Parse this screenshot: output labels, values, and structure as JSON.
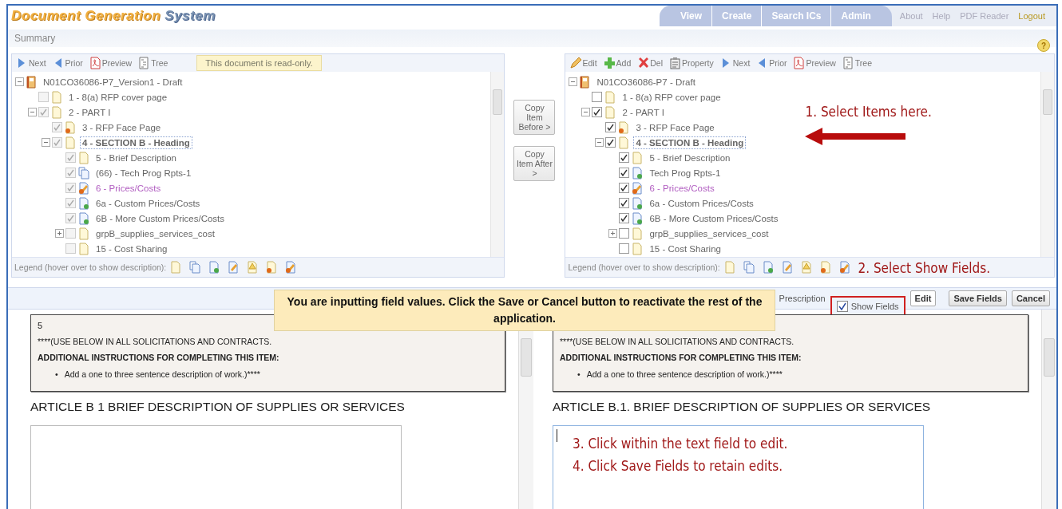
{
  "header": {
    "logo_part_1": "Document Generation",
    "logo_part_2": "System",
    "nav_tabs": [
      "View",
      "Create",
      "Search ICs",
      "Admin"
    ],
    "links": [
      {
        "label": "About",
        "kind": "plain"
      },
      {
        "label": "Help",
        "kind": "plain"
      },
      {
        "label": "PDF Reader",
        "kind": "plain"
      },
      {
        "label": "Logout",
        "kind": "logout"
      }
    ]
  },
  "summary_bar": {
    "title": "Summary",
    "help": "?"
  },
  "left_panel": {
    "disabled": true,
    "notice": "This document is read-only.",
    "toolbar": [
      {
        "label": "Next",
        "kind": "next"
      },
      {
        "label": "Prior",
        "kind": "prior"
      },
      {
        "label": "Preview",
        "kind": "pdf"
      },
      {
        "label": "Tree",
        "kind": "tree"
      }
    ],
    "tree": {
      "label": "N01CO36086-P7_Version1 - Draft",
      "kind": "book",
      "expanded": true,
      "selected": false,
      "children": [
        {
          "label": "1 - 8(a) RFP cover page",
          "kind": "page",
          "checked": false,
          "selected": false
        },
        {
          "label": "2 - PART I",
          "kind": "page",
          "checked": true,
          "selected": false,
          "expanded": true,
          "children": [
            {
              "label": "3 - RFP Face Page",
              "kind": "page-dot",
              "checked": true,
              "selected": false
            },
            {
              "label": "4 - SECTION B - Heading",
              "kind": "page",
              "checked": true,
              "selected": true,
              "expanded": true,
              "children": [
                {
                  "label": "5 - Brief Description",
                  "kind": "page",
                  "checked": true,
                  "selected": false
                },
                {
                  "label": "(66) - Tech Prog Rpts-1",
                  "kind": "stack",
                  "checked": true,
                  "selected": false
                },
                {
                  "label": "6 - Prices/Costs",
                  "kind": "edit-dot",
                  "checked": true,
                  "selected": false,
                  "color": "#b05cc0"
                },
                {
                  "label": "6a - Custom Prices/Costs",
                  "kind": "page-plus",
                  "checked": true,
                  "selected": false
                },
                {
                  "label": "6B - More Custom Prices/Costs",
                  "kind": "page-plus",
                  "checked": true,
                  "selected": false
                },
                {
                  "label": "grpB_supplies_services_cost",
                  "kind": "page",
                  "checked": false,
                  "selected": false,
                  "expanded": false
                },
                {
                  "label": "15 - Cost Sharing",
                  "kind": "page",
                  "checked": false,
                  "selected": false
                }
              ]
            }
          ]
        }
      ]
    },
    "legend": "Legend (hover over to show description):"
  },
  "copy_buttons": [
    "Copy Item Before >",
    "Copy Item After >"
  ],
  "right_panel": {
    "disabled": false,
    "toolbar": [
      {
        "label": "Edit",
        "kind": "edit"
      },
      {
        "label": "Add",
        "kind": "add"
      },
      {
        "label": "Del",
        "kind": "del"
      },
      {
        "label": "Property",
        "kind": "property"
      },
      {
        "label": "Next",
        "kind": "next"
      },
      {
        "label": "Prior",
        "kind": "prior"
      },
      {
        "label": "Preview",
        "kind": "pdf"
      },
      {
        "label": "Tree",
        "kind": "tree"
      }
    ],
    "tree": {
      "label": "N01CO36086-P7 - Draft",
      "kind": "book",
      "expanded": true,
      "selected": false,
      "children": [
        {
          "label": "1 - 8(a) RFP cover page",
          "kind": "page",
          "checked": false,
          "selected": false
        },
        {
          "label": "2 - PART I",
          "kind": "page",
          "checked": true,
          "selected": false,
          "expanded": true,
          "children": [
            {
              "label": "3 - RFP Face Page",
              "kind": "page-dot",
              "checked": true,
              "selected": false
            },
            {
              "label": "4 - SECTION B - Heading",
              "kind": "page",
              "checked": true,
              "selected": true,
              "expanded": true,
              "children": [
                {
                  "label": "5 - Brief Description",
                  "kind": "page",
                  "checked": true,
                  "selected": false
                },
                {
                  "label": "Tech Prog Rpts-1",
                  "kind": "page-plus",
                  "checked": true,
                  "selected": false
                },
                {
                  "label": "6 - Prices/Costs",
                  "kind": "edit-dot",
                  "checked": true,
                  "selected": false,
                  "color": "#b05cc0"
                },
                {
                  "label": "6a - Custom Prices/Costs",
                  "kind": "page-plus",
                  "checked": true,
                  "selected": false
                },
                {
                  "label": "6B - More Custom Prices/Costs",
                  "kind": "page-plus",
                  "checked": true,
                  "selected": false
                },
                {
                  "label": "grpB_supplies_services_cost",
                  "kind": "page",
                  "checked": false,
                  "selected": false,
                  "expanded": false
                },
                {
                  "label": "15 - Cost Sharing",
                  "kind": "page",
                  "checked": false,
                  "selected": false
                }
              ]
            }
          ]
        }
      ]
    },
    "legend": "Legend (hover over to show description):",
    "annotation_1": "1. Select Items here.",
    "annotation_2": "2. Select Show Fields."
  },
  "field_toolbar": {
    "prescription": "Prescription",
    "show_fields": {
      "label": "Show Fields",
      "checked": true
    },
    "buttons": [
      "Edit",
      "Save Fields",
      "Cancel"
    ]
  },
  "notice": "You are inputting field values. Click the Save or Cancel button to reactivate the rest of the application.",
  "documents": [
    {
      "number": "5",
      "instruction_1": "****(USE BELOW IN ALL SOLICITATIONS AND CONTRACTS.",
      "instruction_2": "ADDITIONAL INSTRUCTIONS FOR COMPLETING THIS ITEM:",
      "bullet_mark": "•",
      "bullet": "Add a one to three sentence description of work.)****",
      "article": "ARTICLE B 1  BRIEF DESCRIPTION OF SUPPLIES OR SERVICES",
      "focused": false
    },
    {
      "instruction_1": "****(USE BELOW IN ALL SOLICITATIONS AND CONTRACTS.",
      "instruction_2": "ADDITIONAL INSTRUCTIONS FOR COMPLETING THIS ITEM:",
      "bullet_mark": "•",
      "bullet": "Add a one to three sentence description of work.)****",
      "article": "ARTICLE B.1. BRIEF DESCRIPTION OF SUPPLIES OR SERVICES",
      "focused": true,
      "annotations": [
        "3.  Click within the text field to edit.",
        "4. Click Save Fields to retain edits."
      ]
    }
  ]
}
